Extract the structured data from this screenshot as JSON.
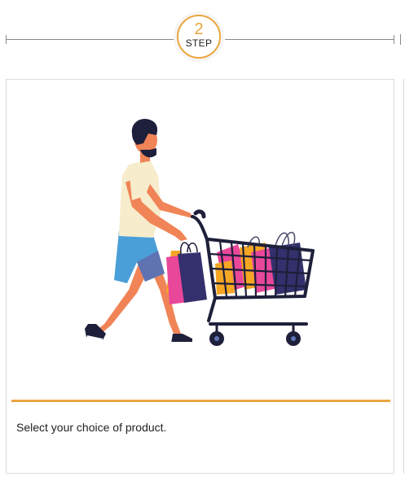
{
  "step": {
    "number": "2",
    "word": "STEP",
    "accent_color": "#eaa63e",
    "line_color": "#8a8a8a"
  },
  "card": {
    "illustration_icon": "shopping-cart-person-illustration",
    "description": "Select your choice of product."
  }
}
